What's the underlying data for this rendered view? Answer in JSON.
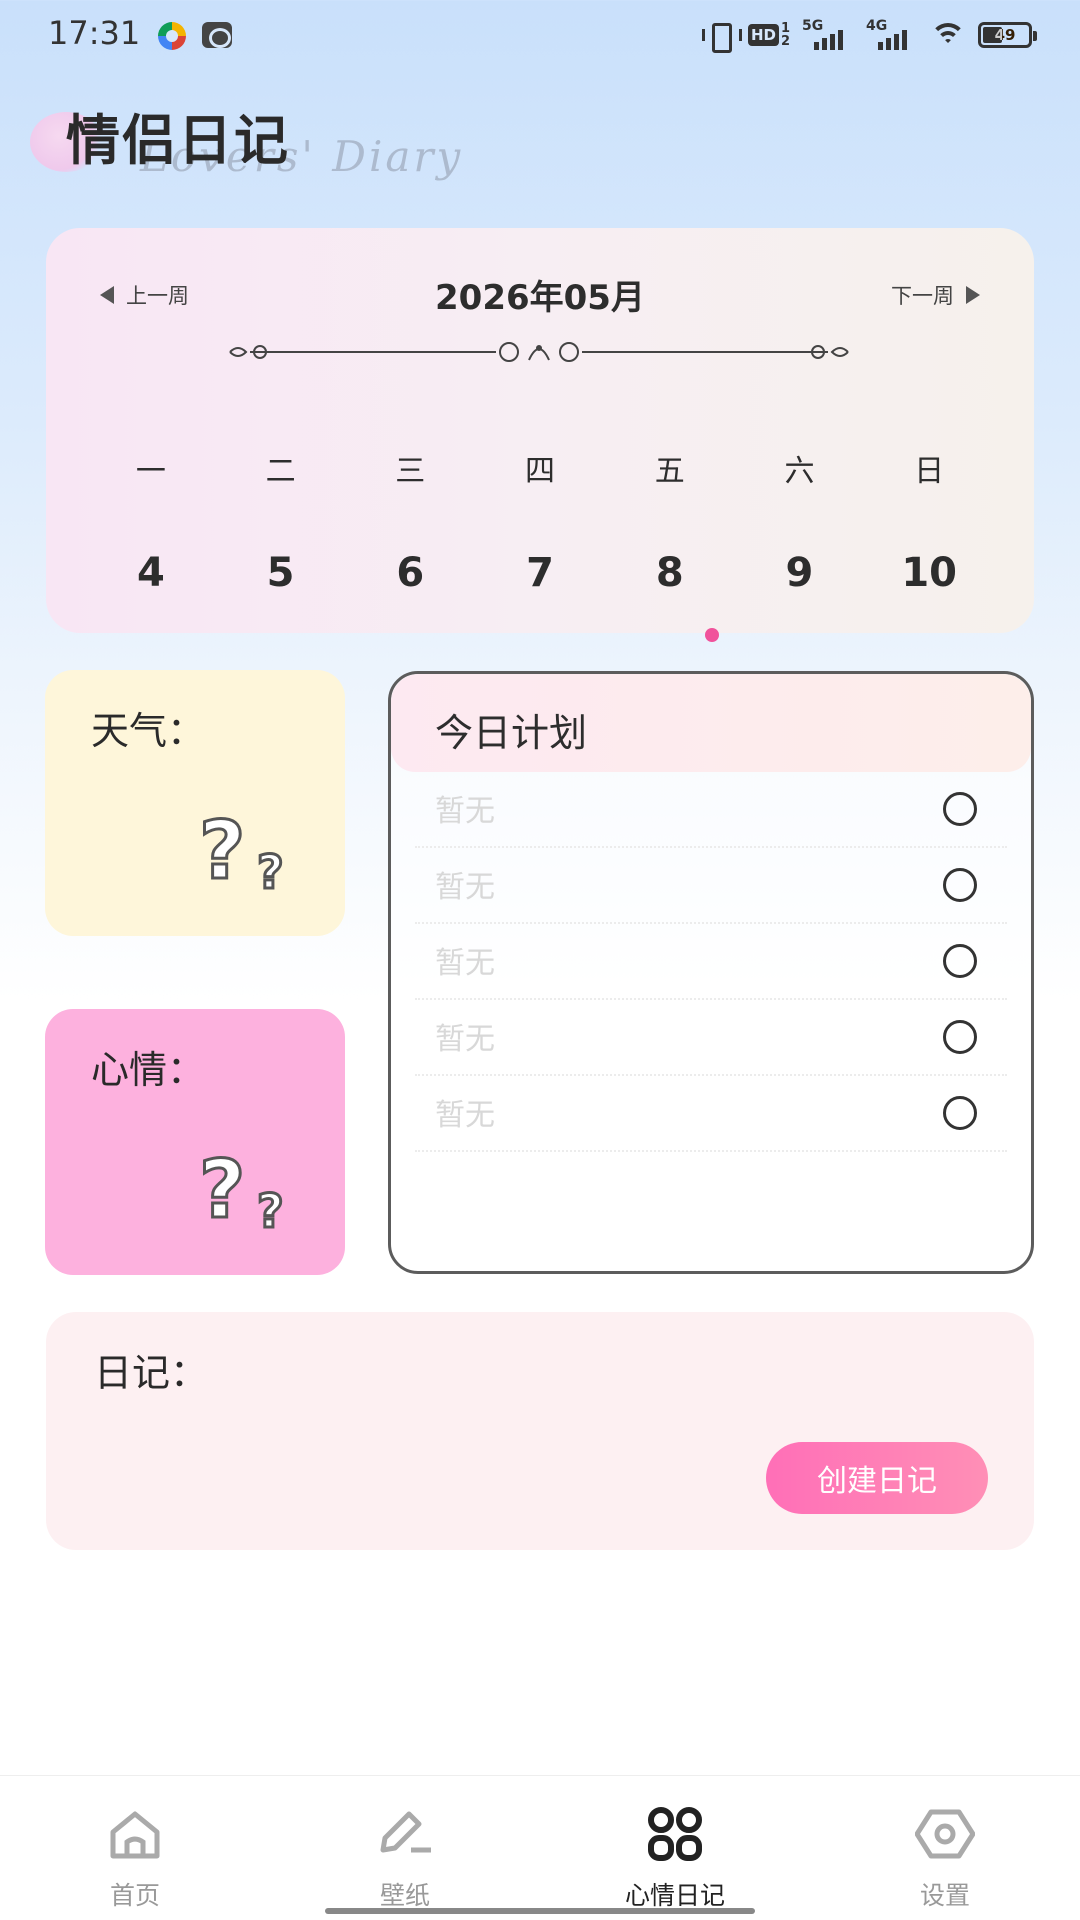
{
  "status_bar": {
    "time": "17:31",
    "hd_label": "HD",
    "hd_sup": "1",
    "hd_sub": "2",
    "net1": "5G",
    "net2": "4G",
    "battery": "49"
  },
  "header": {
    "title": "情侣日记",
    "subtitle": "Lovers' Diary"
  },
  "calendar": {
    "prev_label": "上一周",
    "next_label": "下一周",
    "month": "2026年05月",
    "weekdays": [
      "一",
      "二",
      "三",
      "四",
      "五",
      "六",
      "日"
    ],
    "dates": [
      "4",
      "5",
      "6",
      "7",
      "8",
      "9",
      "10"
    ],
    "today_index": 4,
    "accent_color": "#f0529b"
  },
  "weather": {
    "label": "天气：",
    "icon": "question-marks-icon"
  },
  "mood": {
    "label": "心情：",
    "icon": "question-marks-icon"
  },
  "plan": {
    "title": "今日计划",
    "items": [
      {
        "text": "暂无"
      },
      {
        "text": "暂无"
      },
      {
        "text": "暂无"
      },
      {
        "text": "暂无"
      },
      {
        "text": "暂无"
      }
    ]
  },
  "diary": {
    "label": "日记：",
    "create_button": "创建日记",
    "button_color": "#ff6fb7"
  },
  "tab_bar": {
    "tabs": [
      {
        "label": "首页",
        "icon": "home-icon"
      },
      {
        "label": "壁纸",
        "icon": "pen-icon"
      },
      {
        "label": "心情日记",
        "icon": "grid-icon"
      },
      {
        "label": "设置",
        "icon": "settings-icon"
      }
    ],
    "active_index": 2
  }
}
